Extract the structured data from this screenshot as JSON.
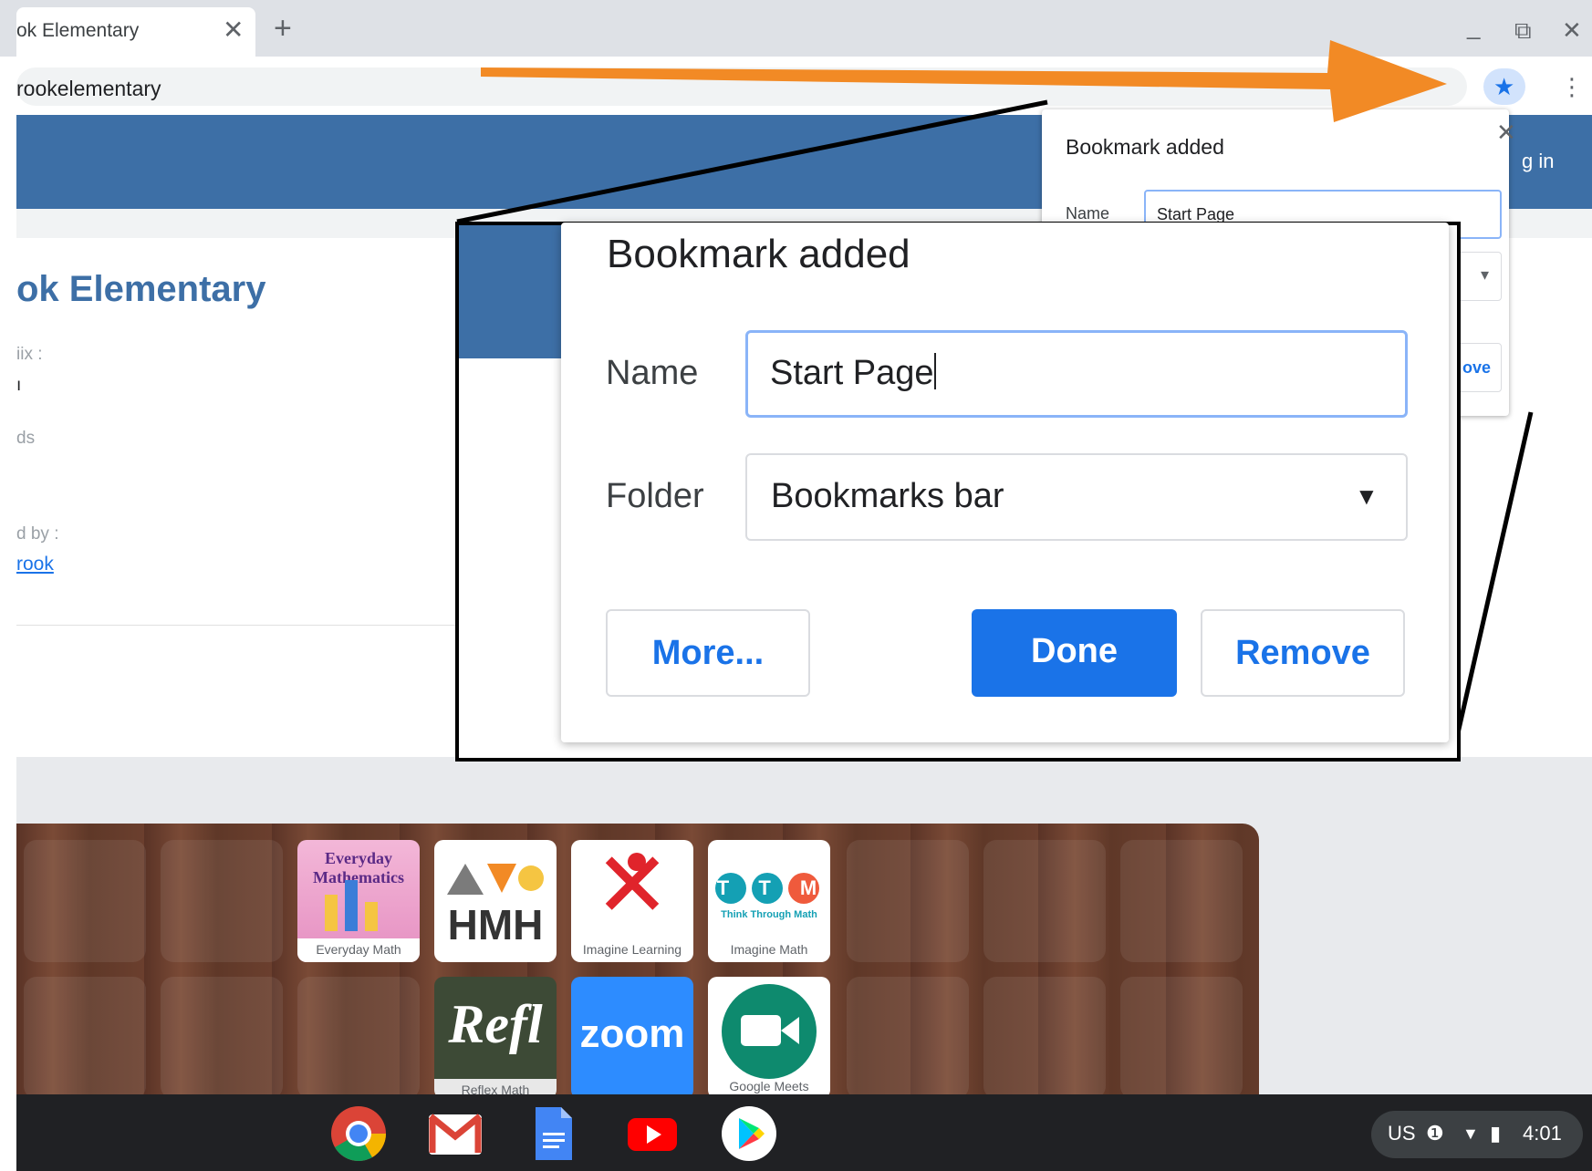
{
  "browser": {
    "tab_title": "ok Elementary",
    "tab_close": "✕",
    "new_tab": "+",
    "window_controls": {
      "minimize": "_",
      "restore": "⧉",
      "close": "✕"
    },
    "url": "rookelementary",
    "bookmark_star_icon": "★",
    "menu_icon": "⋮"
  },
  "page": {
    "sign_in": "g in",
    "school_title": "ok Elementary",
    "meta": [
      "iix :",
      "ı",
      "ds",
      "d by :"
    ],
    "meta_link": "rook"
  },
  "small_popup": {
    "title": "Bookmark added",
    "close": "✕",
    "name_label": "Name",
    "name_value": "Start Page",
    "dropdown_arrow": "▾",
    "button_partial": "ove"
  },
  "zoom_dialog": {
    "title": "Bookmark added",
    "name_label": "Name",
    "name_value": "Start Page",
    "folder_label": "Folder",
    "folder_value": "Bookmarks bar",
    "dropdown_arrow": "▼",
    "more_button": "More...",
    "done_button": "Done",
    "remove_button": "Remove"
  },
  "apps": [
    {
      "name": "Everyday Mathematics",
      "logo": "Everyday Mathematics",
      "label": "Everyday Math"
    },
    {
      "name": "HMH",
      "logo": "HMH",
      "label": ""
    },
    {
      "name": "Imagine Learning",
      "logo": "✕",
      "label": "Imagine Learning"
    },
    {
      "name": "Imagine Math",
      "logo": "T T M",
      "sublogo": "Think Through Math",
      "label": "Imagine Math"
    },
    {
      "name": "Reflex Math",
      "logo": "Refl",
      "label": "Reflex Math"
    },
    {
      "name": "Zoom",
      "logo": "zoom",
      "label": ""
    },
    {
      "name": "Google Meets",
      "logo": "▶",
      "label": "Google Meets"
    }
  ],
  "status": {
    "locale": "US",
    "time": "4:01",
    "info_icon": "❶",
    "wifi_icon": "▼",
    "battery_icon": "▮"
  },
  "colors": {
    "accent": "#1a73e8",
    "header_blue": "#3d6fa6",
    "arrow_orange": "#f28a25"
  }
}
